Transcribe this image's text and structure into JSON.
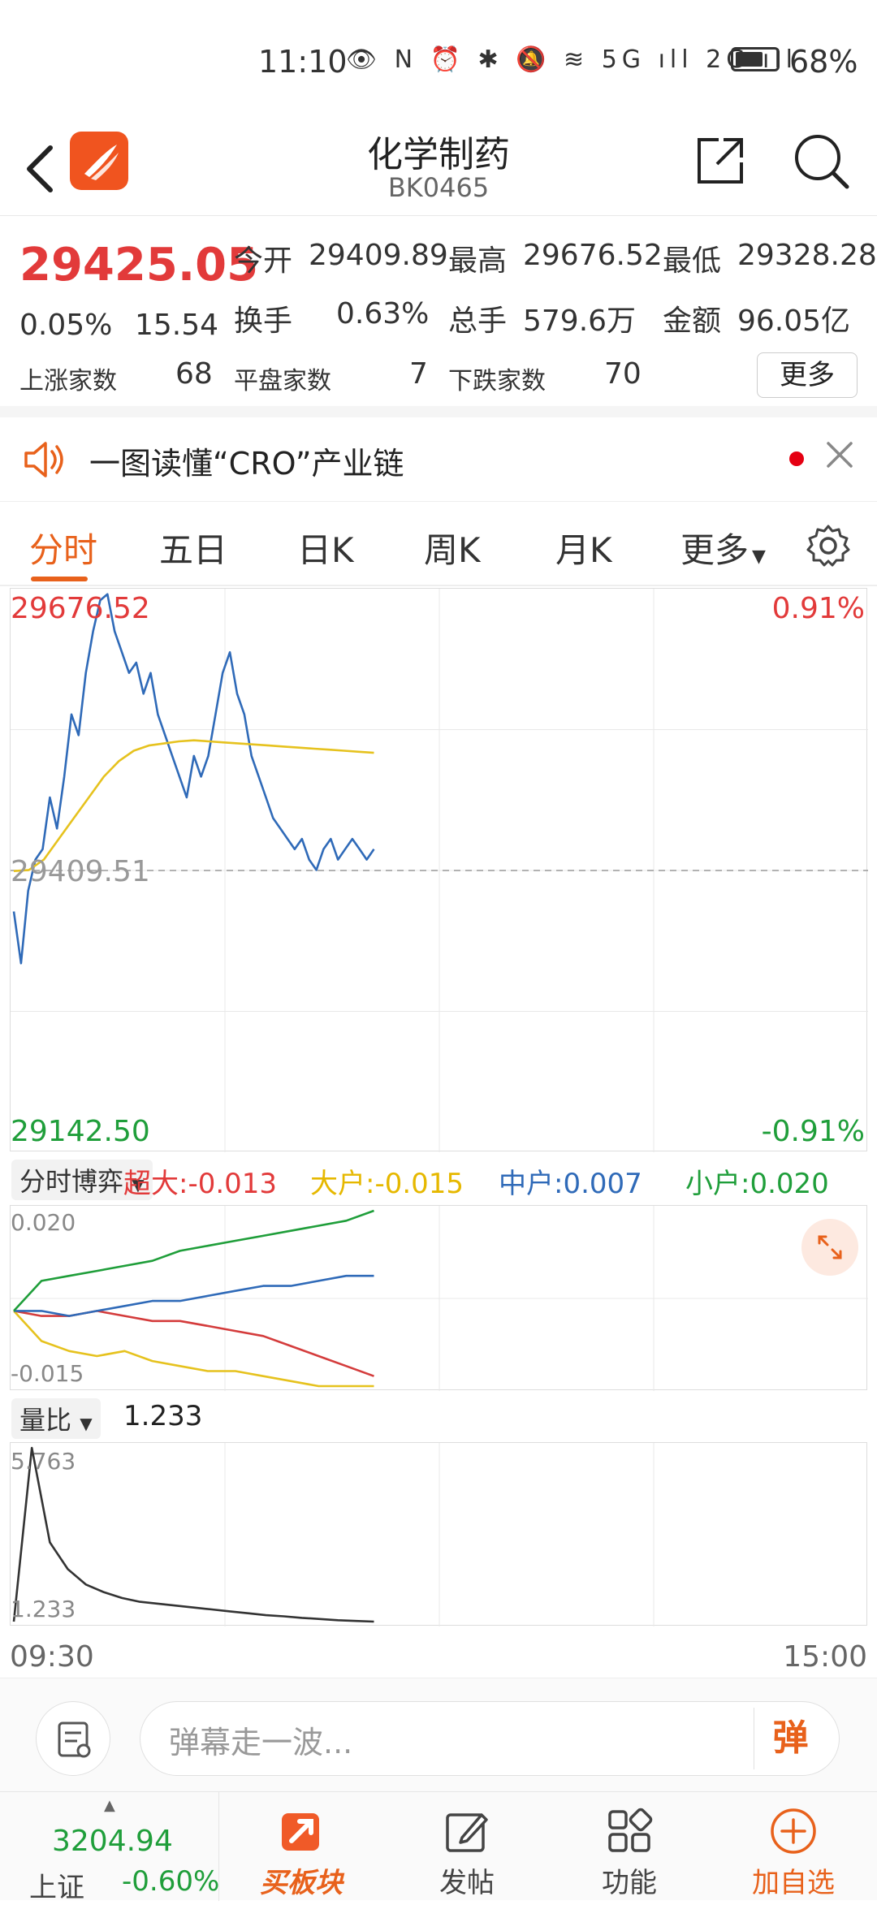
{
  "status": {
    "time": "11:10",
    "icons": "👁 N ⏰ ✱ 🔕 ≋ 5G ıll 2G ıll",
    "battery_pct": "68%",
    "battery_level": 0.68
  },
  "header": {
    "title": "化学制药",
    "code": "BK0465"
  },
  "quote": {
    "price": "29425.05",
    "change_pct": "0.05%",
    "change_val": "15.54",
    "open_label": "今开",
    "open": "29409.89",
    "high_label": "最高",
    "high": "29676.52",
    "low_label": "最低",
    "low": "29328.28",
    "turnover_label": "换手",
    "turnover": "0.63%",
    "volume_label": "总手",
    "volume": "579.6万",
    "amount_label": "金额",
    "amount": "96.05亿",
    "up_label": "上涨家数",
    "up": "68",
    "flat_label": "平盘家数",
    "flat": "7",
    "down_label": "下跌家数",
    "down": "70",
    "more": "更多"
  },
  "notice": {
    "text": "一图读懂“CRO”产业链"
  },
  "tabs": {
    "t1": "分时",
    "t2": "五日",
    "t3": "日K",
    "t4": "周K",
    "t5": "月K",
    "t6": "更多"
  },
  "chart_main": {
    "top_price": "29676.52",
    "mid_price": "29409.51",
    "bottom_price": "29142.50",
    "top_pct": "0.91%",
    "bottom_pct": "-0.91%"
  },
  "boyi": {
    "selector": "分时博弈",
    "chaoda": "超大:-0.013",
    "dahu": "大户:-0.015",
    "zhonghu": "中户:0.007",
    "xiaohu": "小户:0.020",
    "max": "0.020",
    "min": "-0.015"
  },
  "ratio": {
    "selector": "量比",
    "value": "1.233",
    "max": "5.763",
    "min": "1.233"
  },
  "time_axis": {
    "start": "09:30",
    "end": "15:00"
  },
  "danmu": {
    "placeholder": "弹幕走一波...",
    "button": "弹"
  },
  "bottom": {
    "index_value": "3204.94",
    "index_name": "上证",
    "index_pct": "-0.60%",
    "b1": "买板块",
    "b2": "发帖",
    "b3": "功能",
    "b4": "加自选"
  },
  "colors": {
    "accent": "#e8611b",
    "up": "#e23a3a",
    "down": "#1f9e3a",
    "price_line": "#2f6ab8",
    "avg_line": "#e6c21e"
  },
  "chart_data": [
    {
      "type": "line",
      "series": [
        {
          "values": [
            29370,
            29320,
            29390,
            29420,
            29430,
            29480,
            29450,
            29500,
            29560,
            29540,
            29600,
            29640,
            29670,
            29676,
            29640,
            29620,
            29600,
            29610,
            29580,
            29600,
            29560,
            29540,
            29520,
            29500,
            29480,
            29520,
            29500,
            29520,
            29560,
            29600,
            29620,
            29580,
            29560,
            29520,
            29500,
            29480,
            29460,
            29450,
            29440,
            29430,
            29440,
            29420,
            29410,
            29430,
            29440,
            29420,
            29430,
            29440,
            29430,
            29420,
            29430
          ]
        },
        {
          "values": [
            29409,
            29410,
            29420,
            29440,
            29460,
            29480,
            29500,
            29515,
            29525,
            29530,
            29532,
            29534,
            29535,
            29534,
            29533,
            29532,
            29531,
            29530,
            29529,
            29528,
            29527,
            29526,
            29525,
            29524,
            29523
          ]
        }
      ],
      "ylim": [
        29142.5,
        29676.52
      ]
    },
    {
      "type": "line",
      "series": [
        {
          "name": "超大",
          "values": [
            0,
            -0.001,
            -0.001,
            0,
            -0.001,
            -0.002,
            -0.002,
            -0.003,
            -0.004,
            -0.005,
            -0.007,
            -0.009,
            -0.011,
            -0.013
          ]
        },
        {
          "name": "大户",
          "values": [
            0,
            -0.006,
            -0.008,
            -0.009,
            -0.008,
            -0.01,
            -0.011,
            -0.012,
            -0.012,
            -0.013,
            -0.014,
            -0.015,
            -0.015,
            -0.015
          ]
        },
        {
          "name": "中户",
          "values": [
            0,
            0,
            -0.001,
            0,
            0.001,
            0.002,
            0.002,
            0.003,
            0.004,
            0.005,
            0.005,
            0.006,
            0.007,
            0.007
          ]
        },
        {
          "name": "小户",
          "values": [
            0,
            0.006,
            0.007,
            0.008,
            0.009,
            0.01,
            0.012,
            0.013,
            0.014,
            0.015,
            0.016,
            0.017,
            0.018,
            0.02
          ]
        }
      ],
      "ylim": [
        -0.015,
        0.02
      ]
    },
    {
      "type": "line",
      "series": [
        {
          "values": [
            1.233,
            5.763,
            3.3,
            2.6,
            2.2,
            2.0,
            1.85,
            1.75,
            1.7,
            1.65,
            1.6,
            1.55,
            1.5,
            1.45,
            1.4,
            1.37,
            1.33,
            1.3,
            1.27,
            1.25,
            1.233
          ]
        }
      ],
      "ylim": [
        1.233,
        5.763
      ]
    }
  ]
}
